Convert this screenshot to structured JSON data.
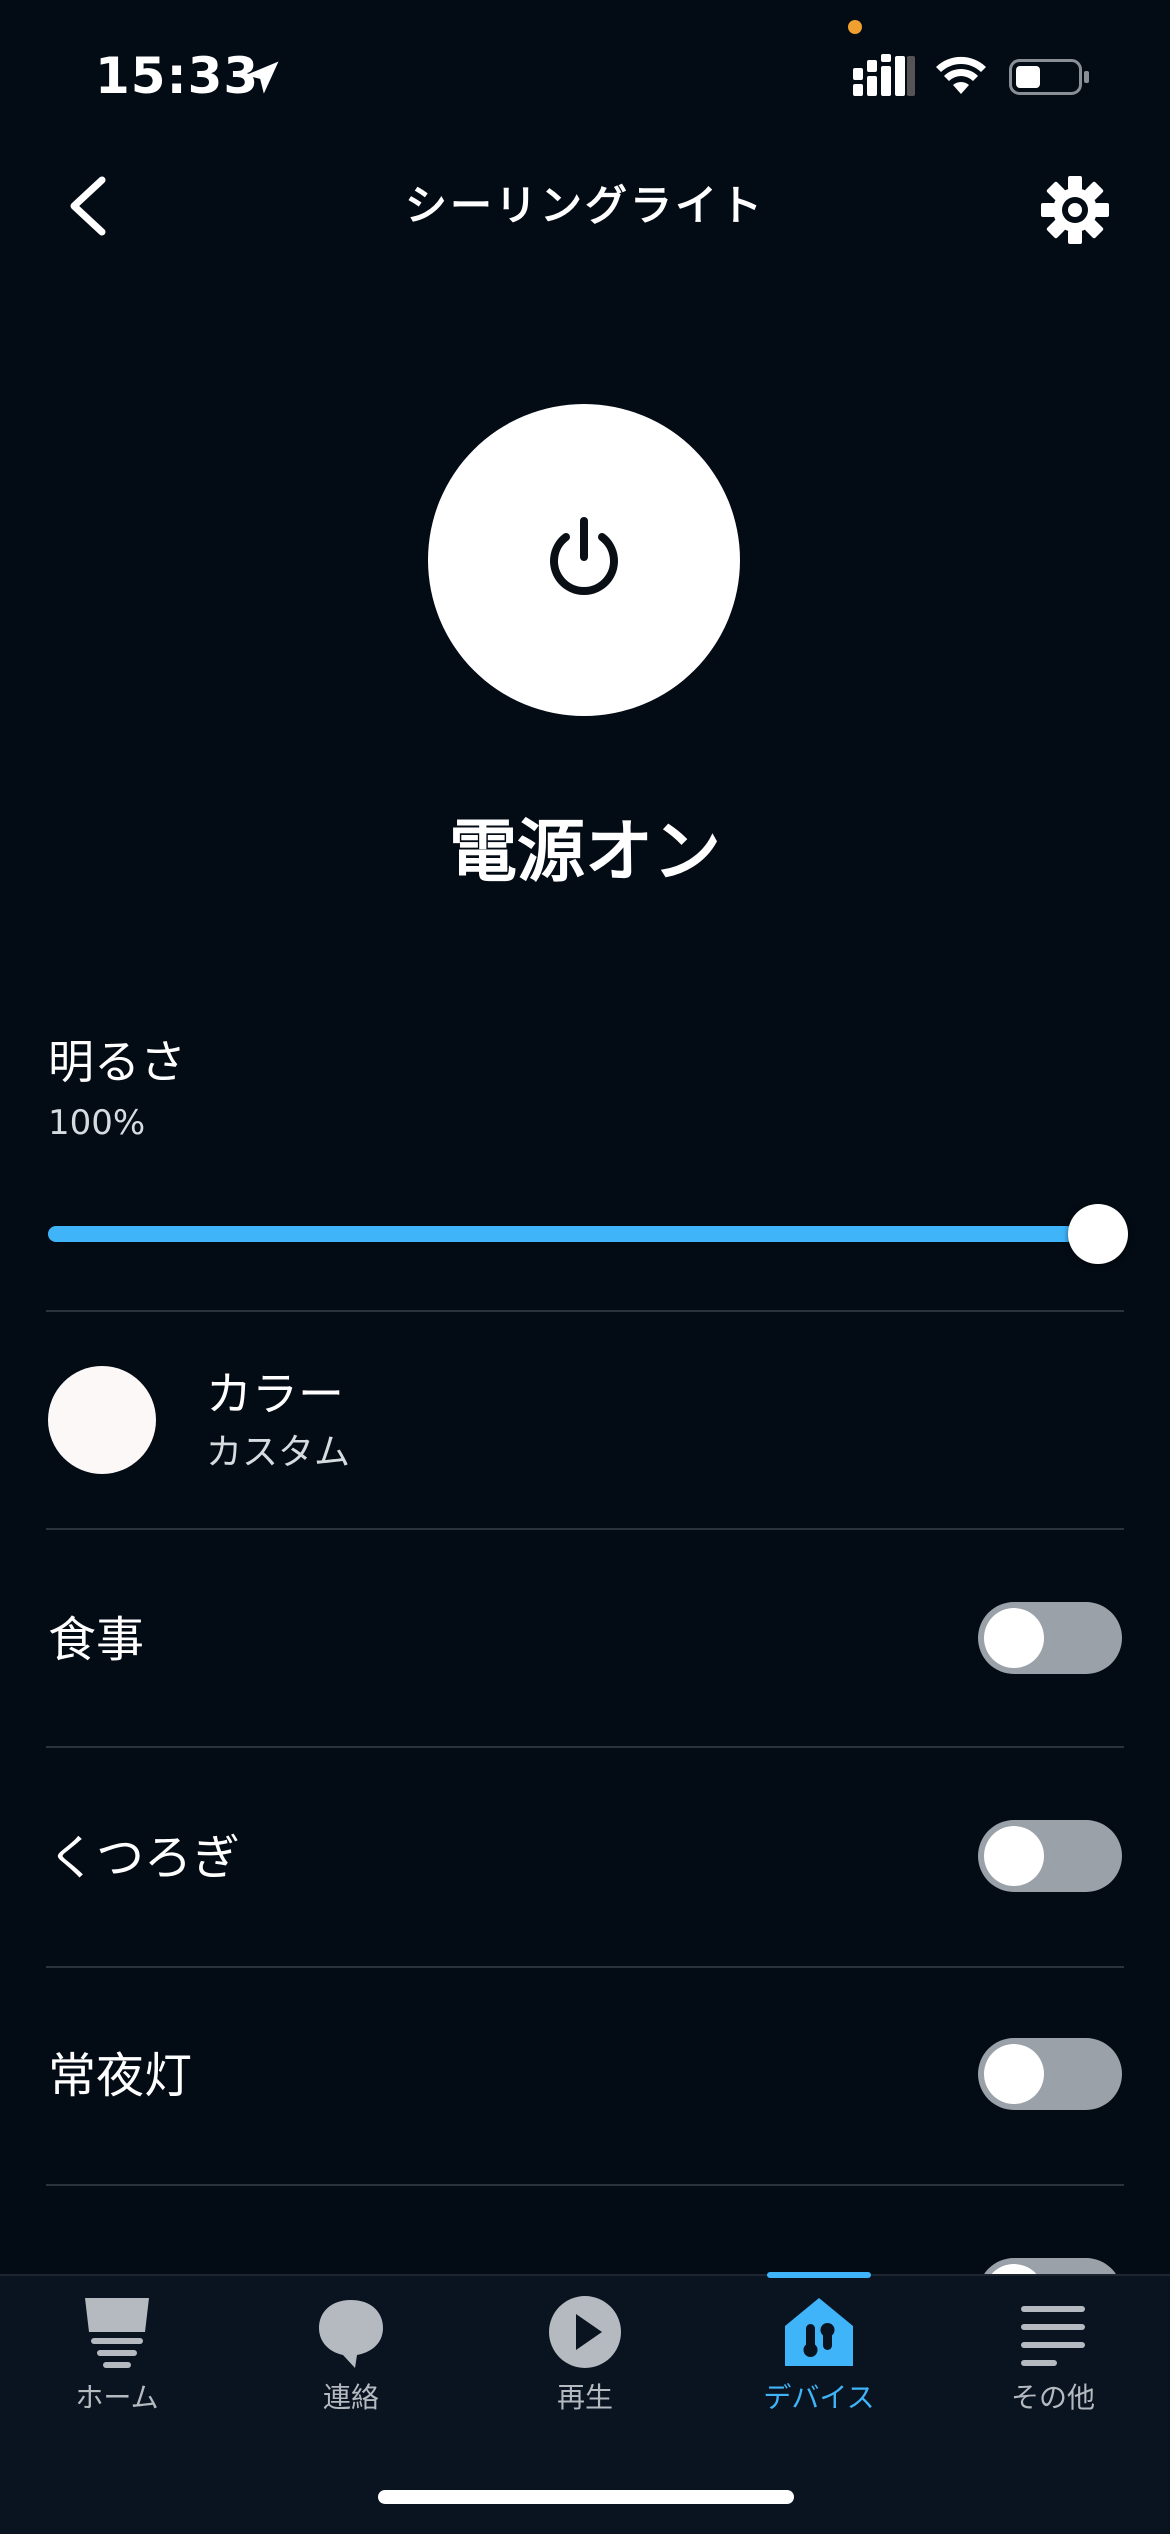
{
  "status_bar": {
    "time": "15:33",
    "location_icon": "location-arrow-icon",
    "signal_icon": "cellular-signal-icon",
    "wifi_icon": "wifi-icon",
    "battery_icon": "battery-icon",
    "recording_dot_color": "#f0a030"
  },
  "header": {
    "title": "シーリングライト",
    "back_icon": "chevron-left-icon",
    "settings_icon": "gear-icon"
  },
  "power": {
    "icon": "power-icon",
    "status": "電源オン"
  },
  "brightness": {
    "label": "明るさ",
    "value_text": "100%",
    "value_fraction": 1.0,
    "accent_color": "#3fb4f8"
  },
  "color": {
    "label": "カラー",
    "value": "カスタム",
    "swatch_color": "#fcf8f8"
  },
  "scenes": [
    {
      "label": "食事",
      "on": false
    },
    {
      "label": "くつろぎ",
      "on": false
    },
    {
      "label": "常夜灯",
      "on": false
    }
  ],
  "tabs": [
    {
      "label": "ホーム",
      "icon": "home-icon",
      "active": false
    },
    {
      "label": "連絡",
      "icon": "speech-bubble-icon",
      "active": false
    },
    {
      "label": "再生",
      "icon": "play-icon",
      "active": false
    },
    {
      "label": "デバイス",
      "icon": "devices-icon",
      "active": true
    },
    {
      "label": "その他",
      "icon": "menu-icon",
      "active": false
    }
  ]
}
